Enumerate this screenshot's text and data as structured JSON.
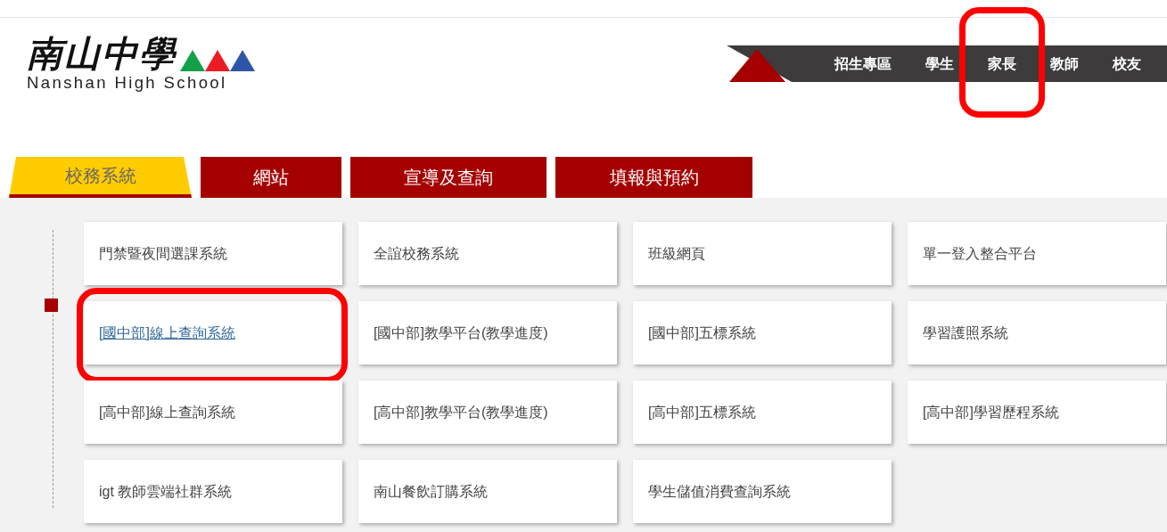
{
  "logo": {
    "chinese": "南山中學",
    "english": "Nanshan High School"
  },
  "nav": [
    {
      "label": "招生專區",
      "highlighted": false
    },
    {
      "label": "學生",
      "highlighted": false
    },
    {
      "label": "家長",
      "highlighted": true
    },
    {
      "label": "教師",
      "highlighted": false
    },
    {
      "label": "校友",
      "highlighted": false
    }
  ],
  "tabs": [
    {
      "label": "校務系統",
      "selected": true
    },
    {
      "label": "網站",
      "selected": false
    },
    {
      "label": "宣導及查詢",
      "selected": false
    },
    {
      "label": "填報與預約",
      "selected": false
    }
  ],
  "systems": [
    {
      "label": "門禁暨夜間選課系統",
      "hovered": false,
      "highlighted": false
    },
    {
      "label": "全誼校務系統",
      "hovered": false,
      "highlighted": false
    },
    {
      "label": "班級網頁",
      "hovered": false,
      "highlighted": false
    },
    {
      "label": "單一登入整合平台",
      "hovered": false,
      "highlighted": false
    },
    {
      "label": "[國中部]線上查詢系統",
      "hovered": true,
      "highlighted": true
    },
    {
      "label": "[國中部]教學平台(教學進度)",
      "hovered": false,
      "highlighted": false
    },
    {
      "label": "[國中部]五標系統",
      "hovered": false,
      "highlighted": false
    },
    {
      "label": "學習護照系統",
      "hovered": false,
      "highlighted": false
    },
    {
      "label": "[高中部]線上查詢系統",
      "hovered": false,
      "highlighted": false
    },
    {
      "label": "[高中部]教學平台(教學進度)",
      "hovered": false,
      "highlighted": false
    },
    {
      "label": "[高中部]五標系統",
      "hovered": false,
      "highlighted": false
    },
    {
      "label": "[高中部]學習歷程系統",
      "hovered": false,
      "highlighted": false
    },
    {
      "label": "igt 教師雲端社群系統",
      "hovered": false,
      "highlighted": false
    },
    {
      "label": "南山餐飲訂購系統",
      "hovered": false,
      "highlighted": false
    },
    {
      "label": "學生儲值消費查詢系統",
      "hovered": false,
      "highlighted": false
    }
  ]
}
